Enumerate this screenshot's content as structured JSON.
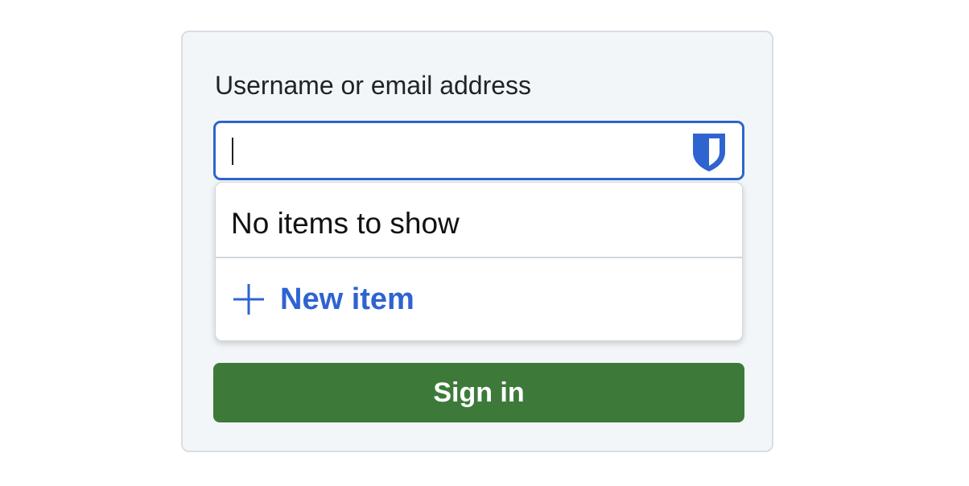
{
  "form": {
    "username_label": "Username or email address",
    "username_value": "",
    "input_icon": "bitwarden-shield-icon"
  },
  "autofill_menu": {
    "empty_message": "No items to show",
    "new_item_icon": "plus-icon",
    "new_item_label": "New item"
  },
  "actions": {
    "sign_in_label": "Sign in"
  },
  "colors": {
    "accent": "#2f63d0",
    "sign_in_button": "#3d7a3a",
    "card_background": "#f3f6f9",
    "card_border": "#d8dee4"
  }
}
